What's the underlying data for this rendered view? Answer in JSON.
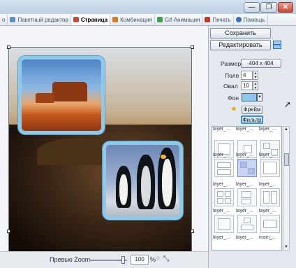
{
  "window": {
    "controls": [
      "minimize",
      "restore",
      "close"
    ],
    "control_glyphs": [
      "—",
      "❐",
      "✕"
    ]
  },
  "tabs": [
    {
      "label": "o",
      "icon": "gear-icon",
      "color": "#7a8ca3"
    },
    {
      "label": "Пакетный редактор",
      "icon": "batch-icon",
      "color": "#5f8fc7"
    },
    {
      "label": "Страница",
      "icon": "page-icon",
      "color": "#c84a3a",
      "active": true
    },
    {
      "label": "Комбинация",
      "icon": "combine-icon",
      "color": "#d27c27"
    },
    {
      "label": "Gif-Анимация",
      "icon": "gif-icon",
      "color": "#3e9e4b"
    },
    {
      "label": "Печать",
      "icon": "print-icon",
      "color": "#c0392b"
    },
    {
      "label": "Помощь",
      "icon": "help-icon",
      "color": "#3c6ebd"
    }
  ],
  "panel": {
    "save_label": "Сохранить",
    "edit_label": "Редактировать",
    "size_label": "Размер",
    "size_value": "404 x 404",
    "margin_label": "Поле",
    "margin_value": "4",
    "oval_label": "Овал",
    "oval_value": "10",
    "background_label": "Фон",
    "background_color": "#8ec6ee",
    "frame_label": "Фрейм",
    "filter_label": "Фильтр"
  },
  "layouts": [
    {
      "label": "layer_..."
    },
    {
      "label": "layer_..."
    },
    {
      "label": "layer_..."
    },
    {
      "label": "layer_..."
    },
    {
      "label": "layer_..."
    },
    {
      "label": "layer_..."
    },
    {
      "label": "layer_..."
    },
    {
      "label": "layer_...",
      "selected": true
    },
    {
      "label": "layer_..."
    },
    {
      "label": "layer_..."
    },
    {
      "label": "layer_..."
    },
    {
      "label": "layer_..."
    },
    {
      "label": "layer_..."
    },
    {
      "label": "layer_..."
    },
    {
      "label": "main_..."
    }
  ],
  "zoom": {
    "label": "Превью Zoom",
    "value": "100",
    "unit": "%",
    "level": 1.0
  }
}
